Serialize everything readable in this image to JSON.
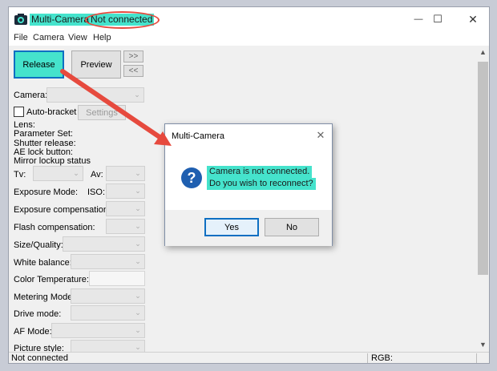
{
  "window": {
    "title": "Multi-Camera",
    "connection_status": "Not connected",
    "buttons": {
      "minimize": "—",
      "maximize": "☐",
      "close": "✕"
    }
  },
  "menu": [
    "File",
    "Camera",
    "View",
    "Help"
  ],
  "controls": {
    "release": "Release",
    "preview": "Preview",
    "next": ">>",
    "prev": "<<",
    "camera_label": "Camera:",
    "auto_bracket": "Auto-bracket",
    "settings": "Settings",
    "info_lines": [
      "Lens:",
      "Parameter Set:",
      "Shutter release:",
      "AE lock button:",
      "Mirror lockup status"
    ],
    "tv": "Tv:",
    "av": "Av:",
    "exposure_mode": "Exposure Mode:",
    "iso": "ISO:",
    "exposure_comp": "Exposure compensation:",
    "flash_comp": "Flash compensation:",
    "size_quality": "Size/Quality:",
    "white_balance": "White balance:",
    "color_temp": "Color Temperature:",
    "metering_mode": "Metering Mode:",
    "drive_mode": "Drive mode:",
    "af_mode": "AF Mode:",
    "picture_style": "Picture style:"
  },
  "statusbar": {
    "left": "Not connected",
    "right": "RGB:"
  },
  "dialog": {
    "title": "Multi-Camera",
    "close": "✕",
    "icon": "?",
    "message_line1": "Camera is not connected.",
    "message_line2": "Do you wish to reconnect?",
    "yes": "Yes",
    "no": "No"
  },
  "colors": {
    "highlight": "#45e3cc",
    "annotation": "#e64a3e",
    "focus": "#0e6fc2"
  },
  "icons": [
    "camera-app-icon",
    "question-icon",
    "close-icon",
    "dropdown-arrow-icon"
  ]
}
